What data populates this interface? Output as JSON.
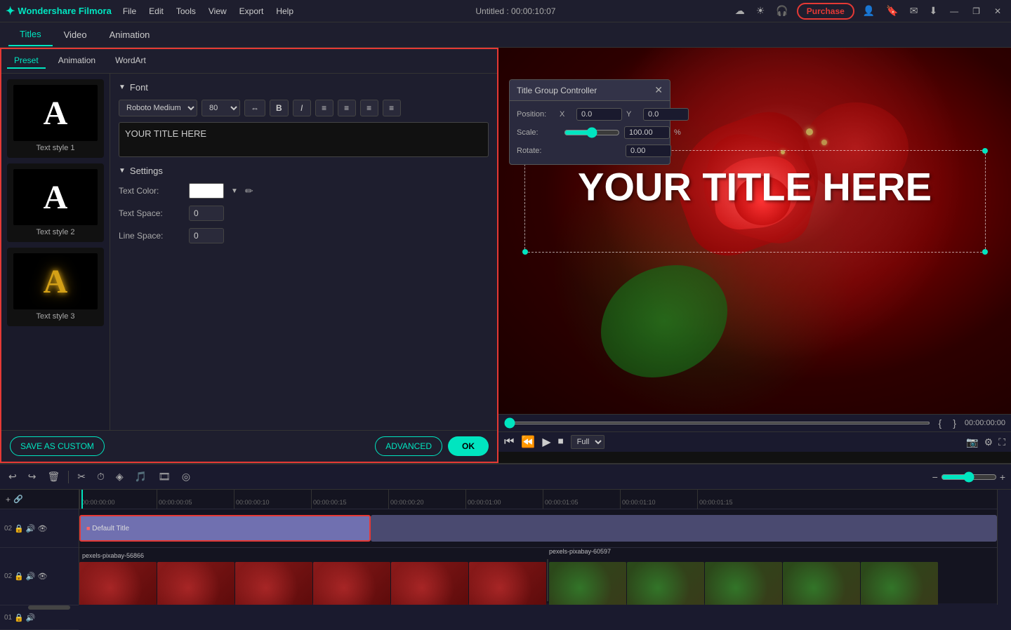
{
  "app": {
    "logo": "Wondershare Filmora",
    "logo_icon": "✦",
    "title": "Untitled : 00:00:10:07",
    "menu": [
      "File",
      "Edit",
      "Tools",
      "View",
      "Export",
      "Help"
    ],
    "purchase_btn": "Purchase",
    "win_btns": [
      "—",
      "❐",
      "✕"
    ]
  },
  "subtabs": [
    "Titles",
    "Video",
    "Animation"
  ],
  "active_subtab": "Titles",
  "preset_tabs": [
    "Preset",
    "Animation",
    "WordArt"
  ],
  "active_preset_tab": "Preset",
  "style_items": [
    {
      "label": "Text style 1",
      "type": "white"
    },
    {
      "label": "Text style 2",
      "type": "white"
    },
    {
      "label": "Text style 3",
      "type": "golden"
    }
  ],
  "font_section": {
    "header": "Font",
    "font_name": "Roboto Medium",
    "font_size": "80",
    "text_content": "YOUR TITLE HERE"
  },
  "settings_section": {
    "header": "Settings",
    "text_color_label": "Text Color:",
    "text_space_label": "Text Space:",
    "text_space_value": "0",
    "line_space_label": "Line Space:",
    "line_space_value": "0"
  },
  "buttons": {
    "save_custom": "SAVE AS CUSTOM",
    "advanced": "ADVANCED",
    "ok": "OK"
  },
  "preview": {
    "title_text": "YOUR TITLE HERE"
  },
  "tgc": {
    "title": "Title Group Controller",
    "position_label": "Position:",
    "x_label": "X",
    "y_label": "Y",
    "x_value": "0.0",
    "y_value": "0.0",
    "scale_label": "Scale:",
    "scale_value": "100.00",
    "scale_pct": "%",
    "rotate_label": "Rotate:",
    "rotate_value": "0.00"
  },
  "playback": {
    "quality": "Full",
    "timecode": "00:00:00:00"
  },
  "timeline": {
    "time_markers": [
      "00:00:00:00",
      "00:00:00:05",
      "00:00:00:10",
      "00:00:00:15",
      "00:00:00:20",
      "00:00:01:00",
      "00:00:01:05",
      "00:00:01:10",
      "00:00:01:15"
    ],
    "title_clip_name": "Default Title",
    "video_track1_name": "pexels-pixabay-56866",
    "video_track2_name": "pexels-pixabay-60597"
  }
}
